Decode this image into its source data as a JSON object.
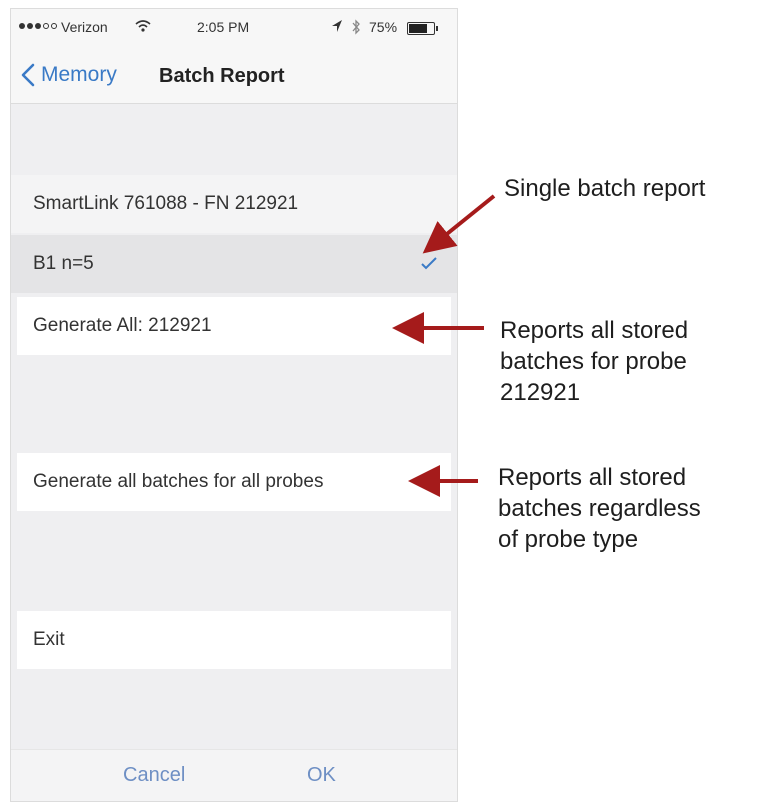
{
  "status_bar": {
    "carrier": "Verizon",
    "time": "2:05 PM",
    "battery": "75%"
  },
  "nav": {
    "back_label": "Memory",
    "title": "Batch Report"
  },
  "list": {
    "device_header": "SmartLink 761088 - FN 212921",
    "batch_row": "B1  n=5",
    "generate_all_row": "Generate All: 212921",
    "generate_all_probes_row": "Generate all batches for all probes",
    "exit_row": "Exit"
  },
  "toolbar": {
    "cancel_label": "Cancel",
    "ok_label": "OK"
  },
  "annotations": {
    "single_batch": "Single batch report",
    "all_for_probe": [
      "Reports all stored",
      "batches for probe",
      "212921"
    ],
    "all_regardless": [
      "Reports all stored",
      "batches  regardless",
      "of probe type"
    ]
  },
  "colors": {
    "accent": "#3a7ac6",
    "toolbar_text": "#6e8fc4",
    "arrow": "#a51b1b",
    "selected_row": "#e4e4e6",
    "background": "#efeff1"
  }
}
